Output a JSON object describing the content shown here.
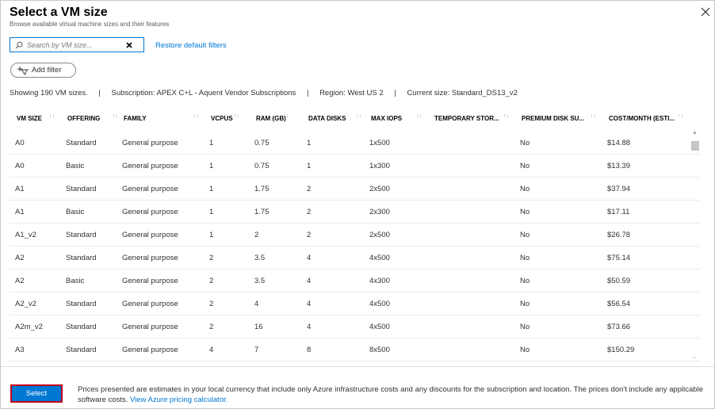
{
  "panel": {
    "title": "Select a VM size",
    "subtitle": "Browse available virtual machine sizes and their features"
  },
  "search": {
    "placeholder": "Search by VM size...",
    "value": ""
  },
  "restore_filters": "Restore default filters",
  "add_filter": "Add filter",
  "info": {
    "count": "Showing 190 VM sizes.",
    "separator": "|",
    "subscription": "Subscription: APEX C+L - Aquent Vendor Subscriptions",
    "region": "Region: West US 2",
    "current_size": "Current size: Standard_DS13_v2"
  },
  "table": {
    "sort_glyph": "↑↓",
    "columns": [
      "VM SIZE",
      "OFFERING",
      "FAMILY",
      "VCPUS",
      "RAM (GB)",
      "DATA DISKS",
      "MAX IOPS",
      "TEMPORARY STOR...",
      "PREMIUM DISK SU...",
      "COST/MONTH (ESTI..."
    ],
    "rows": [
      [
        "A0",
        "Standard",
        "General purpose",
        "1",
        "0.75",
        "1",
        "1x500",
        "",
        "No",
        "$14.88"
      ],
      [
        "A0",
        "Basic",
        "General purpose",
        "1",
        "0.75",
        "1",
        "1x300",
        "",
        "No",
        "$13.39"
      ],
      [
        "A1",
        "Standard",
        "General purpose",
        "1",
        "1.75",
        "2",
        "2x500",
        "",
        "No",
        "$37.94"
      ],
      [
        "A1",
        "Basic",
        "General purpose",
        "1",
        "1.75",
        "2",
        "2x300",
        "",
        "No",
        "$17.11"
      ],
      [
        "A1_v2",
        "Standard",
        "General purpose",
        "1",
        "2",
        "2",
        "2x500",
        "",
        "No",
        "$26.78"
      ],
      [
        "A2",
        "Standard",
        "General purpose",
        "2",
        "3.5",
        "4",
        "4x500",
        "",
        "No",
        "$75.14"
      ],
      [
        "A2",
        "Basic",
        "General purpose",
        "2",
        "3.5",
        "4",
        "4x300",
        "",
        "No",
        "$50.59"
      ],
      [
        "A2_v2",
        "Standard",
        "General purpose",
        "2",
        "4",
        "4",
        "4x500",
        "",
        "No",
        "$56.54"
      ],
      [
        "A2m_v2",
        "Standard",
        "General purpose",
        "2",
        "16",
        "4",
        "4x500",
        "",
        "No",
        "$73.66"
      ],
      [
        "A3",
        "Standard",
        "General purpose",
        "4",
        "7",
        "8",
        "8x500",
        "",
        "No",
        "$150.29"
      ]
    ]
  },
  "footer": {
    "select_label": "Select",
    "note": "Prices presented are estimates in your local currency that include only Azure infrastructure costs and any discounts for the subscription and location. The prices don't include any applicable software costs.",
    "link": "View Azure pricing calculator."
  },
  "colors": {
    "accent": "#0078d4",
    "select_outline": "#c4001a"
  },
  "icons": {
    "close": "close-icon",
    "search": "search-icon",
    "clear": "clear-icon",
    "filter": "add-filter-icon"
  }
}
